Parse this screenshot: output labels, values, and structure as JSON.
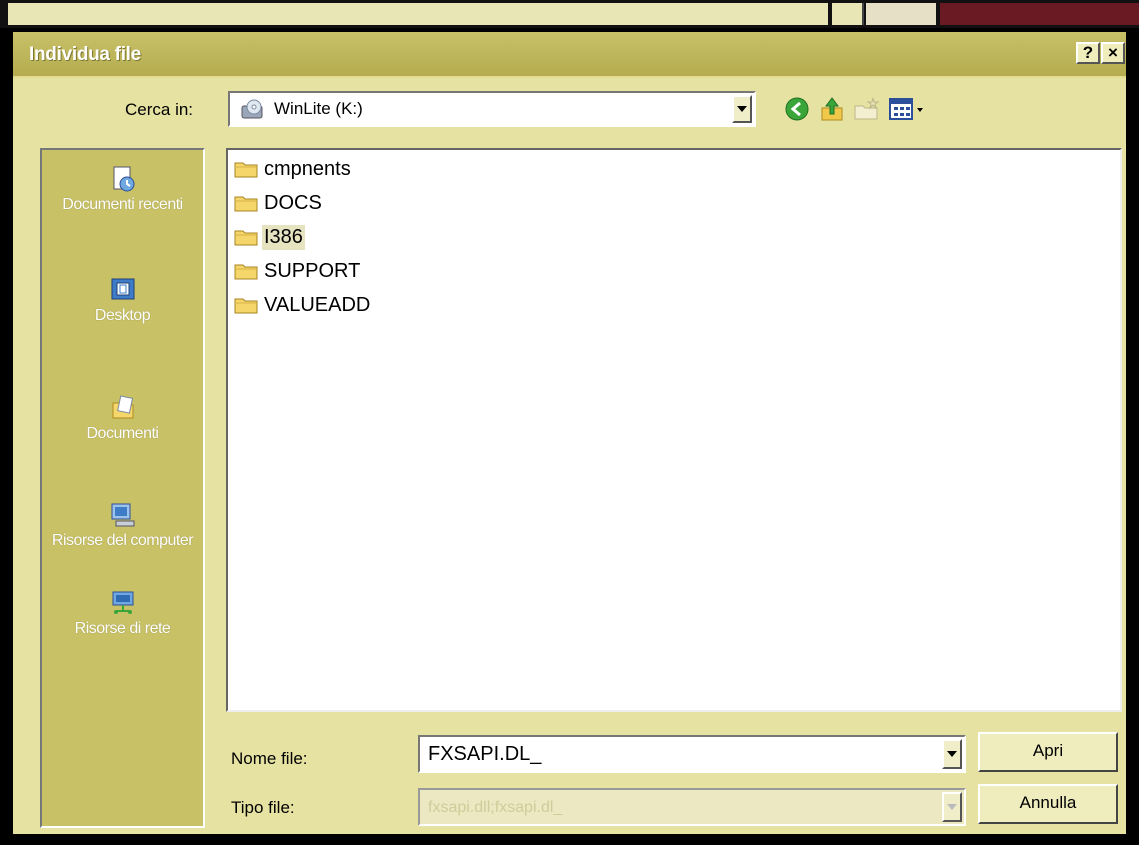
{
  "dialog": {
    "title": "Individua file",
    "help_label": "?",
    "close_label": "×"
  },
  "lookin": {
    "label": "Cerca in:",
    "value": "WinLite (K:)"
  },
  "toolbar": {
    "icons": [
      "back-icon",
      "up-folder-icon",
      "new-folder-icon",
      "views-menu-icon"
    ]
  },
  "places": [
    {
      "label": "Documenti recenti",
      "icon": "recent-documents-icon"
    },
    {
      "label": "Desktop",
      "icon": "desktop-icon"
    },
    {
      "label": "Documenti",
      "icon": "documents-icon"
    },
    {
      "label": "Risorse del computer",
      "icon": "my-computer-icon"
    },
    {
      "label": "Risorse di rete",
      "icon": "network-icon"
    }
  ],
  "files": [
    {
      "name": "cmpnents",
      "selected": false
    },
    {
      "name": "DOCS",
      "selected": false
    },
    {
      "name": "I386",
      "selected": true
    },
    {
      "name": "SUPPORT",
      "selected": false
    },
    {
      "name": "VALUEADD",
      "selected": false
    }
  ],
  "filename": {
    "label": "Nome file:",
    "value": "FXSAPI.DL_"
  },
  "filetype": {
    "label": "Tipo file:",
    "value": "fxsapi.dll;fxsapi.dl_"
  },
  "buttons": {
    "open": "Apri",
    "cancel": "Annulla"
  },
  "colors": {
    "dialog_bg": "#e6e2a2",
    "titlebar": "#b4ac4e",
    "places_bg": "#c8c166",
    "selection": "#e6e3c0"
  }
}
